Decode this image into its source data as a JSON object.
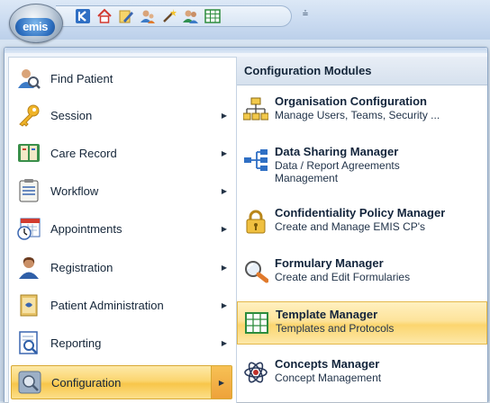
{
  "app": {
    "logo_text": "emis"
  },
  "quick_access": {
    "icons": [
      "back-arrow-icon",
      "home-icon",
      "edit-icon",
      "users-icon",
      "wand-icon",
      "patients-icon",
      "grid-icon"
    ],
    "customize_label": "⩮"
  },
  "left_menu": {
    "items": [
      {
        "label": "Find Patient",
        "icon": "find-patient-icon",
        "has_submenu": false
      },
      {
        "label": "Session",
        "icon": "key-icon",
        "has_submenu": true
      },
      {
        "label": "Care Record",
        "icon": "care-record-icon",
        "has_submenu": true
      },
      {
        "label": "Workflow",
        "icon": "workflow-icon",
        "has_submenu": true
      },
      {
        "label": "Appointments",
        "icon": "calendar-icon",
        "has_submenu": true
      },
      {
        "label": "Registration",
        "icon": "registration-icon",
        "has_submenu": true
      },
      {
        "label": "Patient Administration",
        "icon": "folder-icon",
        "has_submenu": true
      },
      {
        "label": "Reporting",
        "icon": "reporting-icon",
        "has_submenu": true
      },
      {
        "label": "Configuration",
        "icon": "configuration-icon",
        "has_submenu": true,
        "active": true
      }
    ],
    "submenu_arrow": "▶"
  },
  "submenu": {
    "title": "Configuration Modules",
    "items": [
      {
        "title": "Organisation Configuration",
        "desc": "Manage Users, Teams, Security ...",
        "icon": "org-chart-icon"
      },
      {
        "title": "Data Sharing Manager",
        "desc": "Data / Report Agreements Management",
        "icon": "data-sharing-icon"
      },
      {
        "title": "Confidentiality Policy Manager",
        "desc": "Create and Manage EMIS CP's",
        "icon": "lock-icon"
      },
      {
        "title": "Formulary Manager",
        "desc": "Create and Edit Formularies",
        "icon": "magnifier-icon"
      },
      {
        "title": "Template Manager",
        "desc": "Templates and Protocols",
        "icon": "template-grid-icon",
        "active": true
      },
      {
        "title": "Concepts Manager",
        "desc": "Concept Management",
        "icon": "atom-icon"
      }
    ]
  },
  "colors": {
    "highlight": "#fbd56f",
    "header_bg": "#d6e1ee",
    "accent_blue": "#2d6fc0"
  }
}
